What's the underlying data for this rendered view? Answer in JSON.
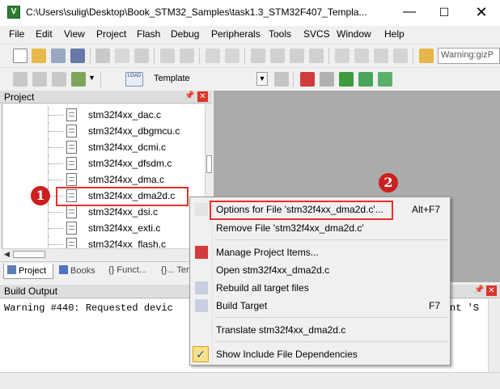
{
  "window": {
    "title": "C:\\Users\\sulig\\Desktop\\Book_STM32_Samples\\task1.3_STM32F407_Templa...",
    "icon_letter": "V",
    "controls": {
      "minimize": "—",
      "maximize": "☐",
      "close": "✕"
    }
  },
  "menu": [
    "File",
    "Edit",
    "View",
    "Project",
    "Flash",
    "Debug",
    "Peripherals",
    "Tools",
    "SVCS",
    "Window",
    "Help"
  ],
  "toolbar": {
    "warning_text": "Warning:gizP",
    "target_label": "Template",
    "load_label": "LOAD"
  },
  "project_panel": {
    "title": "Project",
    "files": [
      "stm32f4xx_dac.c",
      "stm32f4xx_dbgmcu.c",
      "stm32f4xx_dcmi.c",
      "stm32f4xx_dfsdm.c",
      "stm32f4xx_dma.c",
      "stm32f4xx_dma2d.c",
      "stm32f4xx_dsi.c",
      "stm32f4xx_exti.c",
      "stm32f4xx_flash.c"
    ],
    "tabs": [
      "Project",
      "Books",
      "{} Funct...",
      "{}... Temp"
    ]
  },
  "build_output": {
    "title": "Build Output",
    "line": "Warning #440: Requested devic",
    "line_tail": "nt 'S"
  },
  "context_menu": {
    "items": [
      {
        "label": "Options for File 'stm32f4xx_dma2d.c'...",
        "shortcut": "Alt+F7"
      },
      {
        "label": "Remove File 'stm32f4xx_dma2d.c'",
        "shortcut": ""
      },
      {
        "label": "Manage Project Items...",
        "shortcut": ""
      },
      {
        "label": "Open stm32f4xx_dma2d.c",
        "shortcut": ""
      },
      {
        "label": "Rebuild all target files",
        "shortcut": ""
      },
      {
        "label": "Build Target",
        "shortcut": "F7"
      },
      {
        "label": "Translate stm32f4xx_dma2d.c",
        "shortcut": ""
      },
      {
        "label": "Show Include File Dependencies",
        "shortcut": ""
      }
    ]
  },
  "annotations": {
    "badge1": "1",
    "badge2": "2"
  },
  "colors": {
    "highlight": "#e8302a",
    "badge": "#cc1f1f",
    "editor_bg": "#ababab"
  }
}
